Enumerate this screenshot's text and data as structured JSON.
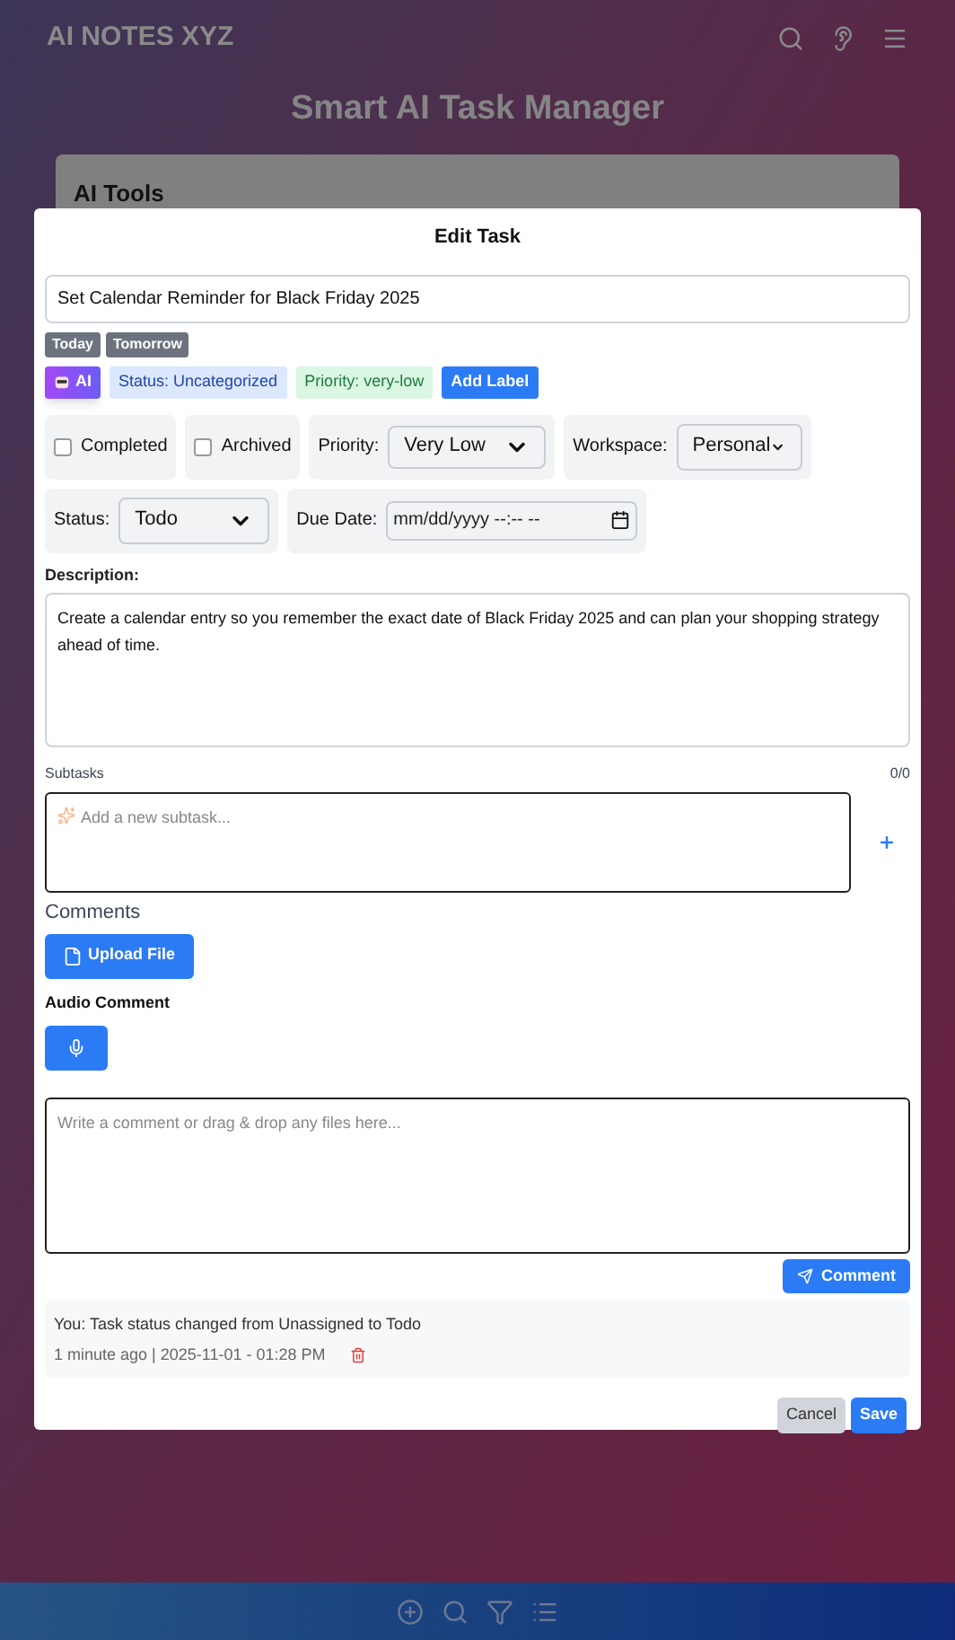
{
  "app": {
    "brand": "AI NOTES XYZ",
    "page_title": "Smart AI Task Manager",
    "card_title": "AI Tools"
  },
  "dialog": {
    "title": "Edit Task",
    "task_title": "Set Calendar Reminder for Black Friday 2025",
    "quick_dates": [
      "Today",
      "Tomorrow"
    ],
    "labels": [
      {
        "kind": "ai",
        "text": "AI"
      },
      {
        "kind": "status",
        "text": "Status: Uncategorized"
      },
      {
        "kind": "priority",
        "text": "Priority: very-low"
      },
      {
        "kind": "add",
        "text": "Add Label"
      }
    ],
    "checkboxes": [
      {
        "label": "Completed",
        "checked": false
      },
      {
        "label": "Archived",
        "checked": false
      }
    ],
    "priority": {
      "label": "Priority:",
      "value": "Very Low"
    },
    "workspace": {
      "label": "Workspace:",
      "value": "Personal"
    },
    "status": {
      "label": "Status:",
      "value": "Todo"
    },
    "due_date": {
      "label": "Due Date:",
      "placeholder": "mm/dd/yyyy --:-- --"
    },
    "description": {
      "label": "Description:",
      "value": "Create a calendar entry so you remember the exact date of Black Friday 2025 and can plan your shopping strategy ahead of time."
    },
    "subtasks": {
      "label": "Subtasks",
      "count": "0/0",
      "placeholder": "Add a new subtask..."
    },
    "comments": {
      "heading": "Comments",
      "upload": "Upload File",
      "audio_label": "Audio Comment",
      "placeholder": "Write a comment or drag & drop any files here...",
      "submit": "Comment"
    },
    "activity": [
      {
        "text": "You: Task status changed from Unassigned to Todo",
        "meta": "1 minute ago | 2025-11-01 - 01:28 PM"
      }
    ],
    "buttons": {
      "cancel": "Cancel",
      "save": "Save"
    }
  }
}
